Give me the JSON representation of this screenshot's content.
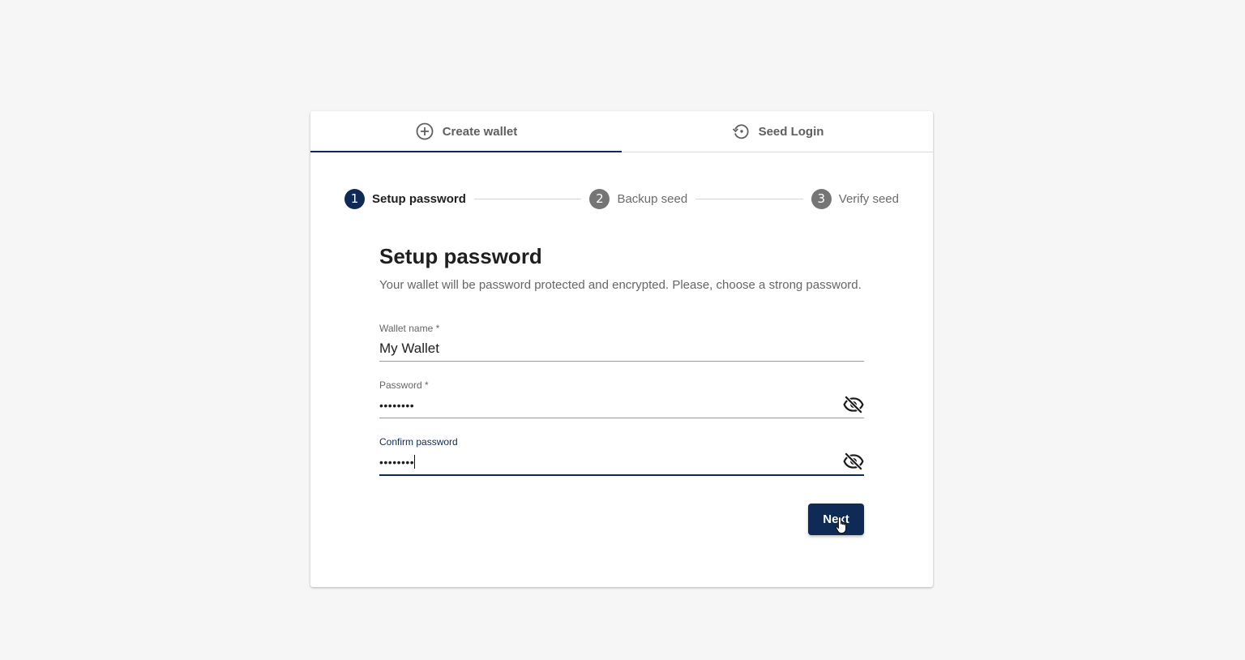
{
  "tabs": [
    {
      "label": "Create wallet",
      "icon": "add-circle-icon",
      "active": true
    },
    {
      "label": "Seed Login",
      "icon": "restore-icon",
      "active": false
    }
  ],
  "stepper": {
    "steps": [
      {
        "number": "1",
        "label": "Setup password",
        "active": true
      },
      {
        "number": "2",
        "label": "Backup seed",
        "active": false
      },
      {
        "number": "3",
        "label": "Verify seed",
        "active": false
      }
    ]
  },
  "form": {
    "title": "Setup password",
    "subtitle": "Your wallet will be password protected and encrypted. Please, choose a strong password.",
    "wallet_name": {
      "label": "Wallet name *",
      "value": "My Wallet"
    },
    "password": {
      "label": "Password *",
      "value": "••••••••"
    },
    "confirm_password": {
      "label": "Confirm password",
      "value": "••••••••"
    },
    "next_label": "Next"
  },
  "colors": {
    "primary": "#0e2a55",
    "inactive_step": "#757575",
    "background": "#f6f6f6"
  }
}
